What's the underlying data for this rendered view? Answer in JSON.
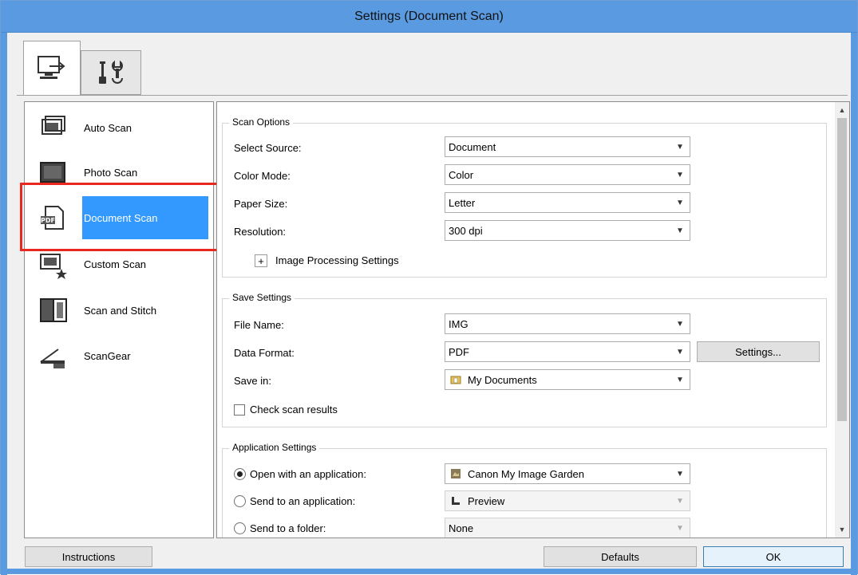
{
  "window": {
    "title": "Settings (Document Scan)"
  },
  "tabs": [
    {
      "id": "scan-from-computer",
      "icon": "computer-scan-icon",
      "active": true
    },
    {
      "id": "general-settings",
      "icon": "tools-icon",
      "active": false
    }
  ],
  "scan_list": {
    "items": [
      {
        "label": "Auto Scan",
        "icon": "auto-scan-icon"
      },
      {
        "label": "Photo Scan",
        "icon": "photo-scan-icon"
      },
      {
        "label": "Document Scan",
        "icon": "document-scan-icon",
        "selected": true
      },
      {
        "label": "Custom Scan",
        "icon": "custom-scan-icon"
      },
      {
        "label": "Scan and Stitch",
        "icon": "scan-and-stitch-icon"
      },
      {
        "label": "ScanGear",
        "icon": "scangear-icon"
      }
    ],
    "doc_icon_text": "PDF"
  },
  "scan_options": {
    "title": "Scan Options",
    "select_source": {
      "label": "Select Source:",
      "value": "Document"
    },
    "color_mode": {
      "label": "Color Mode:",
      "value": "Color"
    },
    "paper_size": {
      "label": "Paper Size:",
      "value": "Letter"
    },
    "resolution": {
      "label": "Resolution:",
      "value": "300 dpi"
    },
    "image_processing": {
      "expander": "+",
      "label": "Image Processing Settings"
    }
  },
  "save_settings": {
    "title": "Save Settings",
    "file_name": {
      "label": "File Name:",
      "value": "IMG"
    },
    "data_format": {
      "label": "Data Format:",
      "value": "PDF",
      "settings_button": "Settings..."
    },
    "save_in": {
      "label": "Save in:",
      "value": "My Documents"
    },
    "check_scan_results": {
      "label": "Check scan results",
      "checked": false
    }
  },
  "application_settings": {
    "title": "Application Settings",
    "open_with": {
      "label": "Open with an application:",
      "value": "Canon My Image Garden",
      "selected": true
    },
    "send_to_app": {
      "label": "Send to an application:",
      "value": "Preview",
      "selected": false
    },
    "send_to_folder": {
      "label": "Send to a folder:",
      "value": "None",
      "selected": false
    }
  },
  "footer": {
    "instructions": "Instructions",
    "defaults": "Defaults",
    "ok": "OK"
  },
  "colors": {
    "title_bar": "#5a9ae0",
    "selection": "#3399ff",
    "highlight": "#e8281e"
  }
}
